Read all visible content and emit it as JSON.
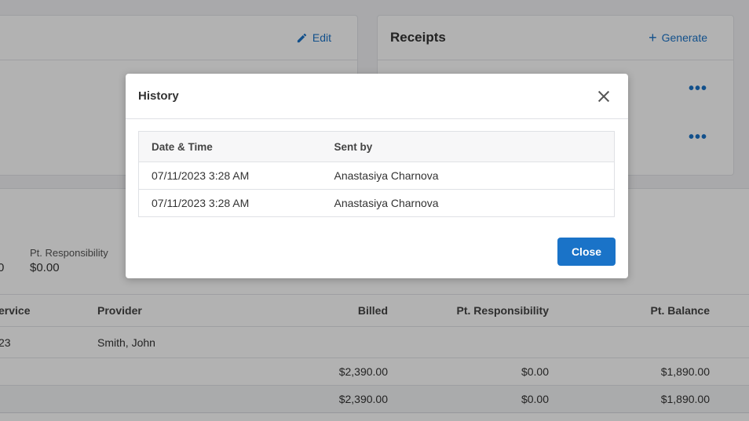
{
  "background": {
    "left_card": {
      "edit_label": "Edit"
    },
    "receipts_card": {
      "title": "Receipts",
      "generate_label": "Generate"
    },
    "summary": {
      "partial_value": "0",
      "pt_responsibility_label": "Pt. Responsibility",
      "pt_responsibility_value": "$0.00"
    },
    "table": {
      "headers": [
        "ervice",
        "Provider",
        "Billed",
        "Pt. Responsibility",
        "Pt. Balance"
      ],
      "rows": [
        {
          "service": "23",
          "provider": "Smith, John",
          "billed": "",
          "pt_responsibility": "",
          "pt_balance": ""
        },
        {
          "service": "",
          "provider": "",
          "billed": "$2,390.00",
          "pt_responsibility": "$0.00",
          "pt_balance": "$1,890.00"
        },
        {
          "service": "",
          "provider": "",
          "billed": "$2,390.00",
          "pt_responsibility": "$0.00",
          "pt_balance": "$1,890.00"
        }
      ]
    }
  },
  "modal": {
    "title": "History",
    "columns": [
      "Date & Time",
      "Sent by"
    ],
    "rows": [
      {
        "datetime": "07/11/2023 3:28 AM",
        "sent_by": "Anastasiya Charnova"
      },
      {
        "datetime": "07/11/2023 3:28 AM",
        "sent_by": "Anastasiya Charnova"
      }
    ],
    "close_button": "Close"
  },
  "colors": {
    "accent": "#1a73c8",
    "overlay": "rgba(0,0,0,0.30)"
  }
}
